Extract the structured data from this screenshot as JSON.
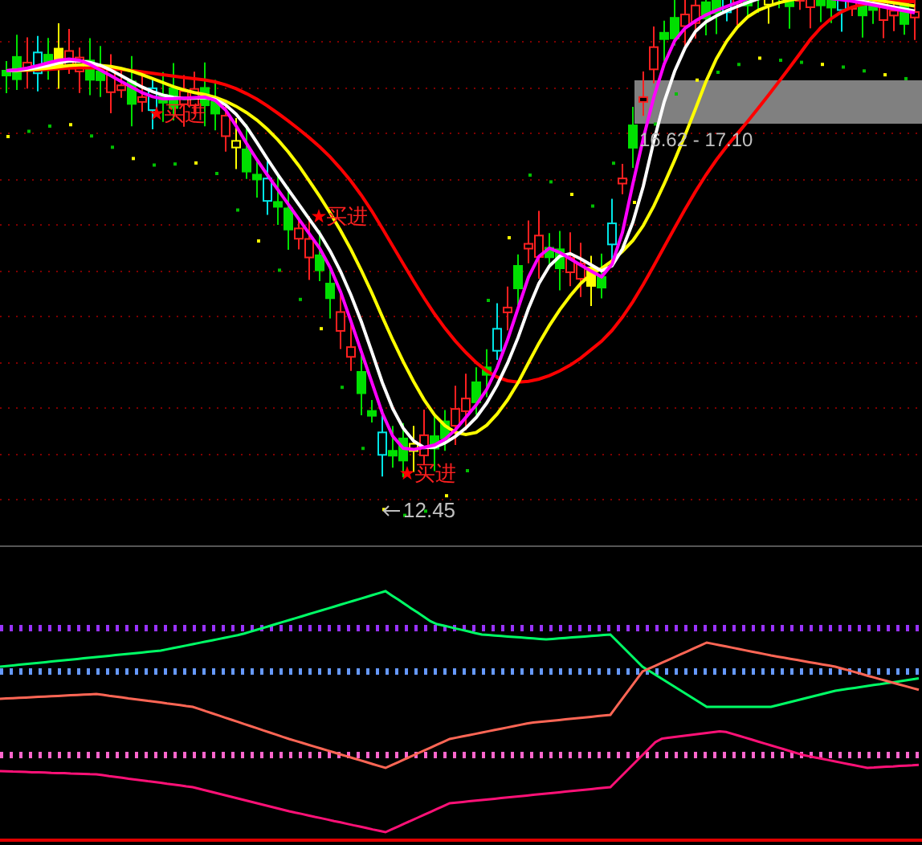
{
  "main_chart": {
    "signals": [
      {
        "label": "买进"
      },
      {
        "label": "买进"
      },
      {
        "label": "买进"
      }
    ],
    "low_price": "12.45",
    "range_band": "16.62 - 17.10"
  }
}
